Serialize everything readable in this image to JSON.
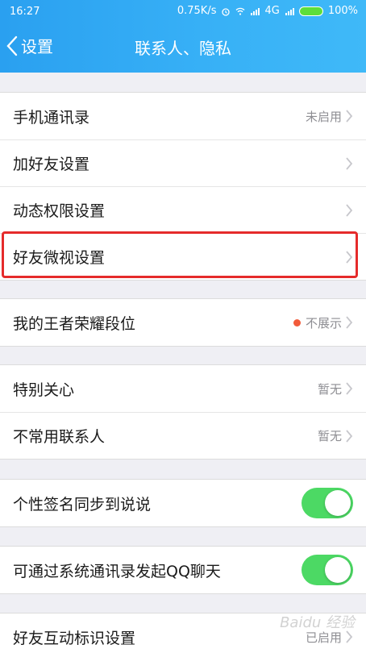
{
  "statusbar": {
    "time": "16:27",
    "speed": "0.75K/s",
    "network": "4G",
    "battery": "100%"
  },
  "header": {
    "back_label": "设置",
    "title": "联系人、隐私"
  },
  "sections": [
    {
      "rows": [
        {
          "label": "手机通讯录",
          "value": "未启用"
        },
        {
          "label": "加好友设置",
          "value": ""
        },
        {
          "label": "动态权限设置",
          "value": ""
        },
        {
          "label": "好友微视设置",
          "value": ""
        }
      ]
    },
    {
      "rows": [
        {
          "label": "我的王者荣耀段位",
          "value": "不展示"
        }
      ]
    },
    {
      "rows": [
        {
          "label": "特别关心",
          "value": "暂无"
        },
        {
          "label": "不常用联系人",
          "value": "暂无"
        }
      ]
    },
    {
      "rows": [
        {
          "label": "个性签名同步到说说",
          "toggle": "on"
        }
      ]
    },
    {
      "rows": [
        {
          "label": "可通过系统通讯录发起QQ聊天",
          "toggle": "on"
        }
      ]
    },
    {
      "rows": [
        {
          "label": "好友互动标识设置",
          "value": "已启用"
        }
      ]
    }
  ],
  "colors": {
    "header": "#37b0f6",
    "toggle_on": "#4cd964",
    "highlight": "#e52b2b",
    "dot": "#f25b3a"
  },
  "watermark": "Baidu 经验"
}
